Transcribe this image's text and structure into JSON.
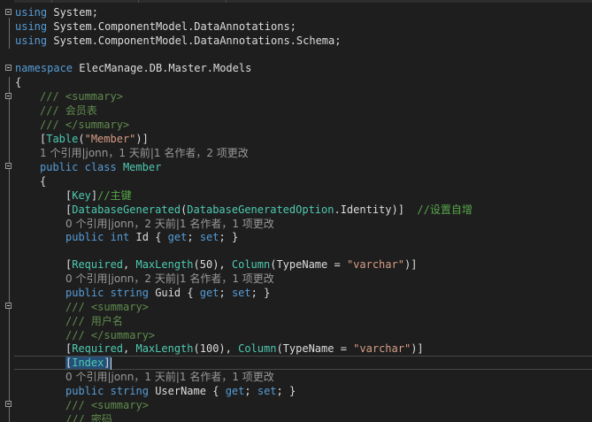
{
  "colors": {
    "background": "#1e1e1e",
    "keyword": "#569cd6",
    "type": "#4ec9b0",
    "comment": "#57a64a",
    "doc_comment": "#608b4e",
    "string": "#d69d85",
    "text": "#dcdcdc",
    "codelens": "#999999",
    "selection": "#264f78"
  },
  "code": {
    "using1": {
      "kw": "using",
      "ns": "System;"
    },
    "using2": {
      "kw": "using",
      "ns": "System.ComponentModel.DataAnnotations;"
    },
    "using3": {
      "kw": "using",
      "ns": "System.ComponentModel.DataAnnotations.Schema;"
    },
    "namespace": {
      "kw": "namespace",
      "name": "ElecManage.DB.Master.Models"
    },
    "open_brace": "{",
    "summary1": {
      "open": "/// <summary>",
      "text": "/// 会员表",
      "close": "/// </summary>"
    },
    "table_attr": {
      "lb": "[",
      "name": "Table",
      "open_paren": "(",
      "arg": "\"Member\"",
      "close": ")]"
    },
    "class_decl": {
      "mod": "public",
      "kw": "class",
      "name": "Member"
    },
    "class_brace": "{",
    "key_attr": {
      "lb": "[",
      "name": "Key",
      "rb": "]",
      "comment": "//主键"
    },
    "dbgen_attr": {
      "lb": "[",
      "name": "DatabaseGenerated",
      "p1": "(",
      "enum_type": "DatabaseGeneratedOption",
      "member": ".Identity)]",
      "comment": "//设置自增"
    },
    "id_prop": {
      "mod": "public",
      "type": "int",
      "name": "Id",
      "ob": "{",
      "get": "get",
      "semi1": ";",
      "set": "set",
      "semi2": ";",
      "cb": "}"
    },
    "guid_attr": {
      "lb": "[",
      "req": "Required",
      "sep1": ", ",
      "maxlen": "MaxLength",
      "maxlen_arg": "(50)",
      "sep2": ", ",
      "col": "Column",
      "col_open": "(TypeName = ",
      "col_val": "\"varchar\"",
      "col_close": ")]"
    },
    "guid_prop": {
      "mod": "public",
      "type": "string",
      "name": "Guid",
      "ob": "{",
      "get": "get",
      "semi1": ";",
      "set": "set",
      "semi2": ";",
      "cb": "}"
    },
    "summary2": {
      "open": "/// <summary>",
      "text": "/// 用户名",
      "close": "/// </summary>"
    },
    "username_attr": {
      "lb": "[",
      "req": "Required",
      "sep1": ", ",
      "maxlen": "MaxLength",
      "maxlen_arg": "(100)",
      "sep2": ", ",
      "col": "Column",
      "col_open": "(TypeName = ",
      "col_val": "\"varchar\"",
      "col_close": ")]"
    },
    "index_attr": {
      "lb": "[",
      "name": "Index",
      "rb": "]"
    },
    "username_prop": {
      "mod": "public",
      "type": "string",
      "name": "UserName",
      "ob": "{",
      "get": "get",
      "semi1": ";",
      "set": "set",
      "semi2": ";",
      "cb": "}"
    },
    "summary3": {
      "open": "/// <summary>",
      "text": "/// 密码"
    }
  },
  "codelens": {
    "table": {
      "refs": "1 个引用",
      "author": "jonn，1 天前",
      "changes": "1 名作者，2 项更改"
    },
    "id": {
      "refs": "0 个引用",
      "author": "jonn，2 天前",
      "changes": "1 名作者，1 项更改"
    },
    "guid": {
      "refs": "0 个引用",
      "author": "jonn，2 天前",
      "changes": "1 名作者，1 项更改"
    },
    "username": {
      "refs": "0 个引用",
      "author": "jonn，1 天前",
      "changes": "1 名作者，1 项更改"
    },
    "sep": "|"
  }
}
